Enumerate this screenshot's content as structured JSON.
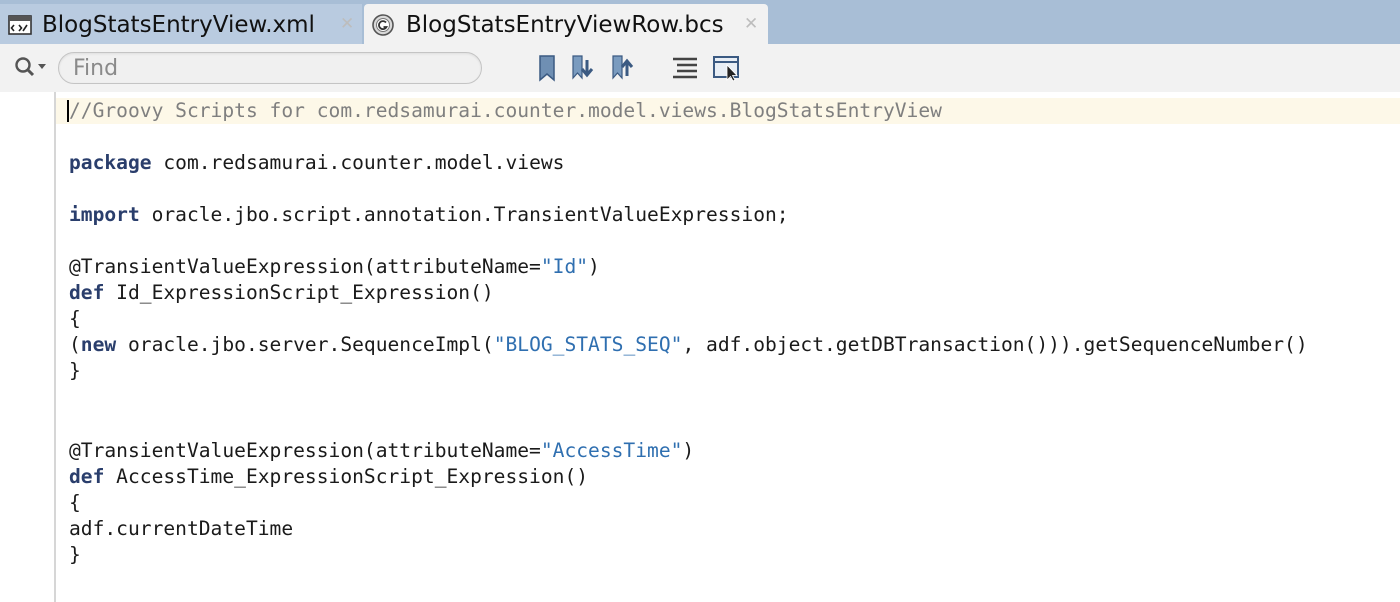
{
  "tabs": [
    {
      "label": "BlogStatsEntryView.xml",
      "icon": "xml-file-icon",
      "active": false
    },
    {
      "label": "BlogStatsEntryViewRow.bcs",
      "icon": "groovy-file-icon",
      "active": true
    }
  ],
  "toolbar": {
    "search_placeholder": "Find",
    "buttons": [
      "bookmark-icon",
      "previous-bookmark-icon",
      "next-bookmark-icon",
      "format-icon",
      "toggle-view-icon"
    ]
  },
  "editor": {
    "lines": [
      {
        "id": "l1",
        "tokens": [
          {
            "t": "//Groovy Scripts for com.redsamurai.counter.model.views.BlogStatsEntryView",
            "c": "comment"
          }
        ]
      },
      {
        "id": "l2",
        "tokens": []
      },
      {
        "id": "l3",
        "tokens": [
          {
            "t": "package",
            "c": "kw"
          },
          {
            "t": " com.redsamurai.counter.model.views",
            "c": ""
          }
        ]
      },
      {
        "id": "l4",
        "tokens": []
      },
      {
        "id": "l5",
        "tokens": [
          {
            "t": "import",
            "c": "kw"
          },
          {
            "t": " oracle.jbo.script.annotation.TransientValueExpression;",
            "c": ""
          }
        ]
      },
      {
        "id": "l6",
        "tokens": []
      },
      {
        "id": "l7",
        "tokens": [
          {
            "t": "@TransientValueExpression(attributeName=",
            "c": ""
          },
          {
            "t": "\"Id\"",
            "c": "str"
          },
          {
            "t": ")",
            "c": ""
          }
        ]
      },
      {
        "id": "l8",
        "tokens": [
          {
            "t": "def",
            "c": "kw"
          },
          {
            "t": " Id_ExpressionScript_Expression()",
            "c": ""
          }
        ]
      },
      {
        "id": "l9",
        "tokens": [
          {
            "t": "{",
            "c": ""
          }
        ]
      },
      {
        "id": "l10",
        "tokens": [
          {
            "t": "(",
            "c": ""
          },
          {
            "t": "new",
            "c": "kw"
          },
          {
            "t": " oracle.jbo.server.SequenceImpl(",
            "c": ""
          },
          {
            "t": "\"BLOG_STATS_SEQ\"",
            "c": "str"
          },
          {
            "t": ", adf.object.getDBTransaction())).getSequenceNumber()",
            "c": ""
          }
        ]
      },
      {
        "id": "l11",
        "tokens": [
          {
            "t": "}",
            "c": ""
          }
        ]
      },
      {
        "id": "l12",
        "tokens": []
      },
      {
        "id": "l13",
        "tokens": []
      },
      {
        "id": "l14",
        "tokens": [
          {
            "t": "@TransientValueExpression(attributeName=",
            "c": ""
          },
          {
            "t": "\"AccessTime\"",
            "c": "str"
          },
          {
            "t": ")",
            "c": ""
          }
        ]
      },
      {
        "id": "l15",
        "tokens": [
          {
            "t": "def",
            "c": "kw"
          },
          {
            "t": " AccessTime_ExpressionScript_Expression()",
            "c": ""
          }
        ]
      },
      {
        "id": "l16",
        "tokens": [
          {
            "t": "{",
            "c": ""
          }
        ]
      },
      {
        "id": "l17",
        "tokens": [
          {
            "t": "adf.currentDateTime",
            "c": ""
          }
        ]
      },
      {
        "id": "l18",
        "tokens": [
          {
            "t": "}",
            "c": ""
          }
        ]
      }
    ]
  },
  "colors": {
    "tabbar": "#a8bed6",
    "active_tab": "#f2f2f2",
    "keyword": "#2a3e6c",
    "string": "#2f6fb0",
    "comment": "#7f7f7f",
    "current_line": "#fdf8e8"
  }
}
